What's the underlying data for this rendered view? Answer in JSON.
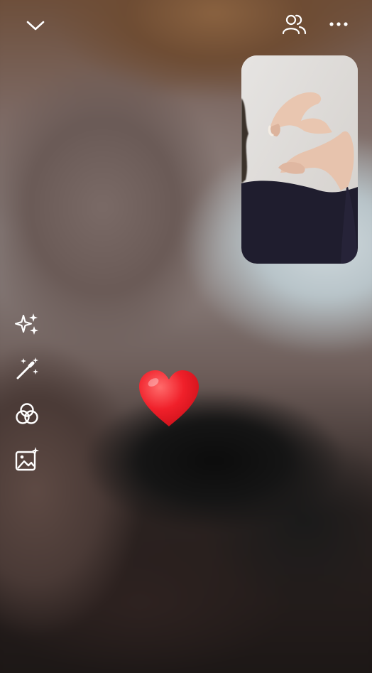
{
  "app": {
    "screen": "video-call",
    "accent": "#ffffff"
  },
  "header": {
    "collapse_icon": "chevron-down-icon",
    "participants_icon": "people-icon",
    "more_icon": "more-horizontal-icon"
  },
  "side_tools": [
    {
      "name": "effects",
      "icon": "sparkles-icon"
    },
    {
      "name": "magic-wand",
      "icon": "magic-wand-icon"
    },
    {
      "name": "filters",
      "icon": "overlapping-circles-icon"
    },
    {
      "name": "backgrounds",
      "icon": "image-sparkle-icon"
    }
  ],
  "reaction": {
    "emoji": "❤️",
    "name": "heart-reaction",
    "color": "#f0202a"
  }
}
